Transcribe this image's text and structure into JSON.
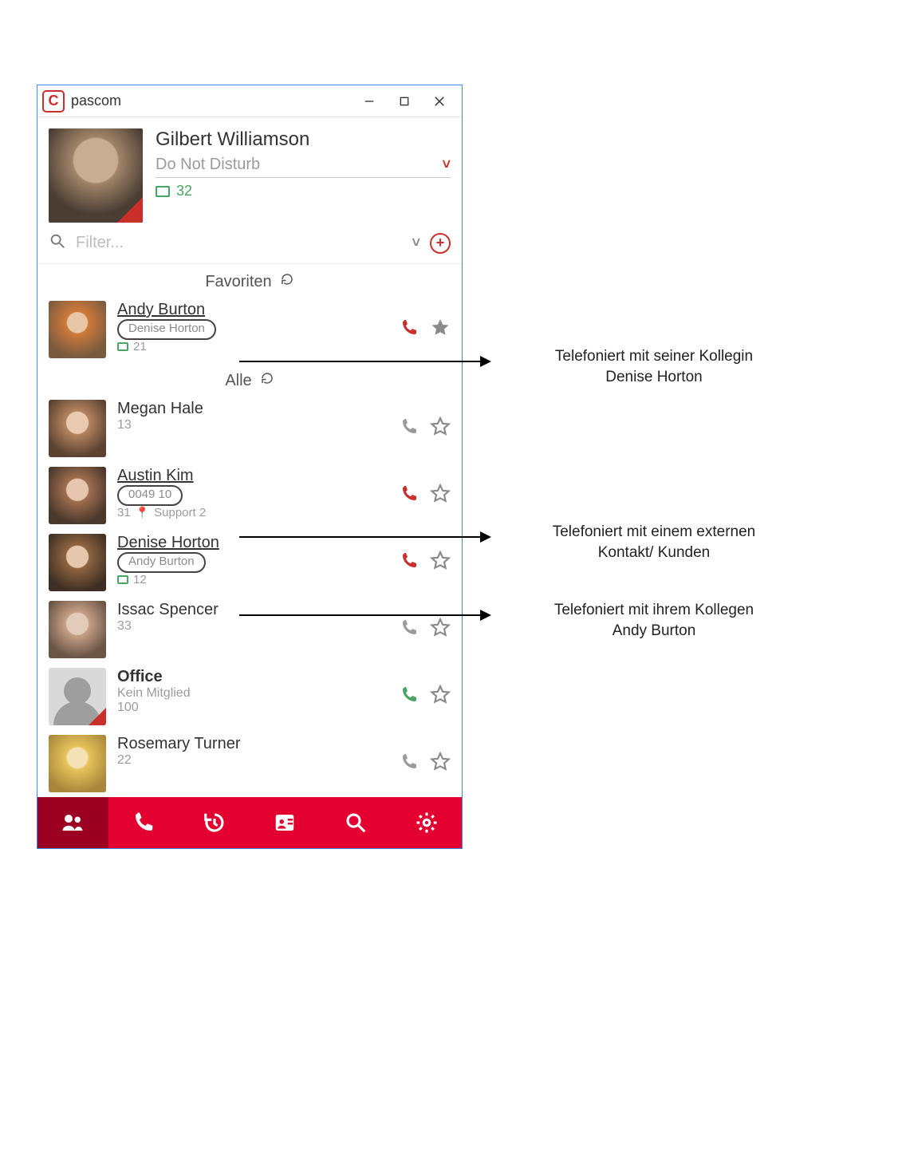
{
  "titlebar": {
    "app_name": "pascom",
    "logo_letter": "C"
  },
  "profile": {
    "name": "Gilbert Williamson",
    "status": "Do Not Disturb",
    "extension": "32"
  },
  "search": {
    "placeholder": "Filter..."
  },
  "sections": {
    "favorites_label": "Favoriten",
    "all_label": "Alle"
  },
  "favorites": [
    {
      "name": "Andy Burton",
      "calling_with": "Denise Horton",
      "extension": "21",
      "underline": true,
      "phone_color": "#c9302c",
      "star_filled": true
    }
  ],
  "contacts": [
    {
      "name": "Megan Hale",
      "sub": "13",
      "underline": false,
      "phone_color": "#9b9b9b",
      "star_filled": false
    },
    {
      "name": "Austin Kim",
      "calling_with": "0049           10",
      "sub_left": "31",
      "location": "Support 2",
      "underline": true,
      "phone_color": "#c9302c",
      "star_filled": false
    },
    {
      "name": "Denise Horton",
      "calling_with": "Andy Burton",
      "extension": "12",
      "underline": true,
      "phone_color": "#c9302c",
      "star_filled": false
    },
    {
      "name": "Issac Spencer",
      "sub": "33",
      "underline": false,
      "phone_color": "#9b9b9b",
      "star_filled": false
    },
    {
      "name": "Office",
      "subtitle": "Kein Mitglied",
      "sub": "100",
      "underline": false,
      "placeholder": true,
      "corner": true,
      "phone_color": "#4aa564",
      "star_filled": false
    },
    {
      "name": "Rosemary Turner",
      "sub": "22",
      "underline": false,
      "phone_color": "#9b9b9b",
      "star_filled": false
    }
  ],
  "annotations": [
    {
      "line1": "Telefoniert mit seiner Kollegin",
      "line2": "Denise Horton"
    },
    {
      "line1": "Telefoniert mit einem externen",
      "line2": "Kontakt/ Kunden"
    },
    {
      "line1": "Telefoniert mit ihrem Kollegen",
      "line2": "Andy Burton"
    }
  ]
}
